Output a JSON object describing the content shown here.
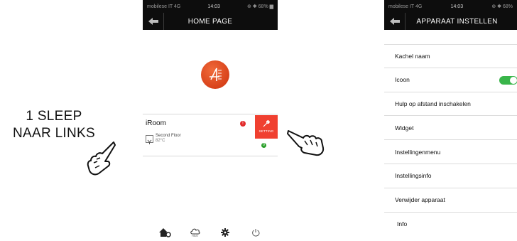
{
  "instruction": {
    "line1": "1 SLEEP",
    "line2": "NAAR LINKS"
  },
  "phone1": {
    "status": {
      "carrier": "mobilese IT 4G",
      "time": "14:03",
      "battery": "⊕ ✱ 68% ▆"
    },
    "header": {
      "title": "HOME PAGE"
    },
    "room": {
      "name": "iRoom",
      "floor": "Second Floor",
      "temperature": "82°C",
      "alert_count": "!",
      "status_count": "0",
      "setting_label": "SETTING"
    },
    "bottom_nav": {
      "heat_label": "HEAT"
    }
  },
  "phone2": {
    "status": {
      "carrier": "mobilese IT 4G",
      "time": "14:03",
      "battery": "⊕ ✱ 68%"
    },
    "header": {
      "title": "APPARAAT INSTELLEN"
    },
    "menu": [
      {
        "label": "Kachel naam"
      },
      {
        "label": "Icoon",
        "toggle": true
      },
      {
        "label": "Hulp op afstand inschakelen"
      },
      {
        "label": "Widget"
      },
      {
        "label": "Instellingenmenu"
      },
      {
        "label": "Instellingsinfo"
      },
      {
        "label": "Verwijder apparaat"
      },
      {
        "label": "Info"
      }
    ]
  },
  "colors": {
    "accent_red": "#f04030",
    "toggle_green": "#39b54a",
    "header_bg": "#0d0d0d",
    "logo_orange": "#d8421a"
  },
  "icons": [
    "hand-pointer-icon",
    "back-arrow-icon",
    "brand-logo",
    "setting-wrench-icon",
    "home-icon",
    "heat-cloud-icon",
    "gear-icon",
    "power-icon"
  ]
}
